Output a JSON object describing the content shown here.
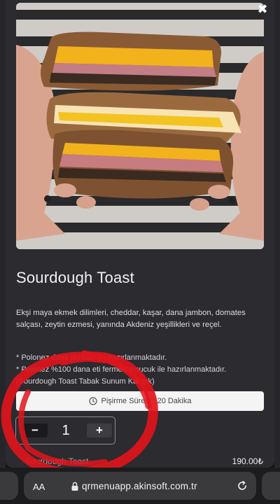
{
  "modal": {
    "close_symbol": "✖",
    "title": "Sourdough Toast",
    "description": "Ekşi maya ekmek dilimleri, cheddar, kaşar, dana jambon, domates salçası, zeytin ezmesi, yanında Akdeniz yeşillikleri ve reçel.",
    "notes": [
      "* Polonez dana jambon ile hazırlanmaktadır.",
      "* Polonez %100 dana eti fermente sucuk ile hazırlanmaktadır.",
      "(Sourdough Toast Tabak Sunum Karışık)"
    ],
    "prep_time": "Pişirme Süresi : 20 Dakika",
    "prep_icon": "clock-icon",
    "quantity": {
      "minus_label": "−",
      "value": "1",
      "plus_label": "+"
    },
    "footer_item_name": "Sourdough Toast",
    "price": "190.00₺"
  },
  "browser": {
    "text_size_label": "AA",
    "url": "qrmenuapp.akinsoft.com.tr",
    "lock_icon": "lock-icon",
    "reload_icon": "reload-icon"
  },
  "colors": {
    "modal_bg": "#2b2b30",
    "scribble": "#e0141c",
    "safari_bar": "#1c1c1e"
  }
}
